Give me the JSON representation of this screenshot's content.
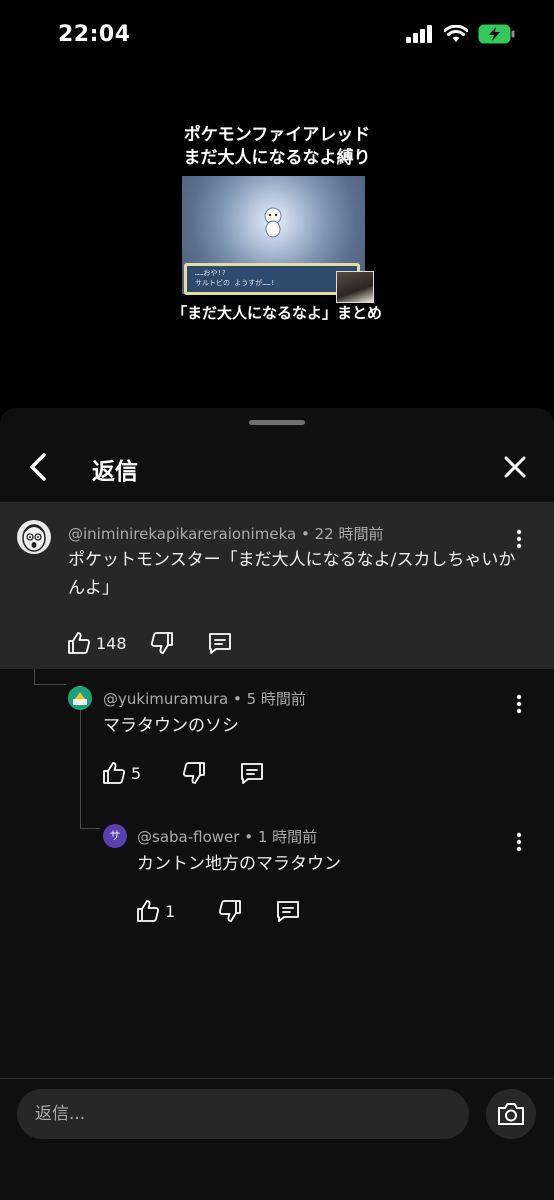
{
  "status_bar": {
    "time": "22:04",
    "battery_charging": true
  },
  "video": {
    "title_line1": "ポケモンファイアレッド",
    "title_line2": "まだ大人になるなよ縛り",
    "dialog_line1": "……おや!?",
    "dialog_line2": "サルトビの ようすが……!",
    "subtitle": "「まだ大人になるなよ」まとめ"
  },
  "sheet": {
    "title": "返信"
  },
  "comments": [
    {
      "handle": "@iniminirekapikareraionimeka",
      "time": "22 時間前",
      "text": "ポケットモンスター「まだ大人になるなよ/スカしちゃいかんよ」",
      "likes": "148"
    },
    {
      "handle": "@yukimuramura",
      "time": "5 時間前",
      "text": "マラタウンのソシ",
      "likes": "5"
    },
    {
      "handle": "@saba-flower",
      "time": "1 時間前",
      "text": "カントン地方のマラタウン",
      "likes": "1",
      "avatar_letter": "サ"
    }
  ],
  "composer": {
    "placeholder": "返信..."
  },
  "colors": {
    "sheet_bg": "#0f0f0f",
    "highlight_bg": "#272727",
    "meta_text": "#aaaaaa",
    "saba_avatar": "#5a3fb0"
  }
}
